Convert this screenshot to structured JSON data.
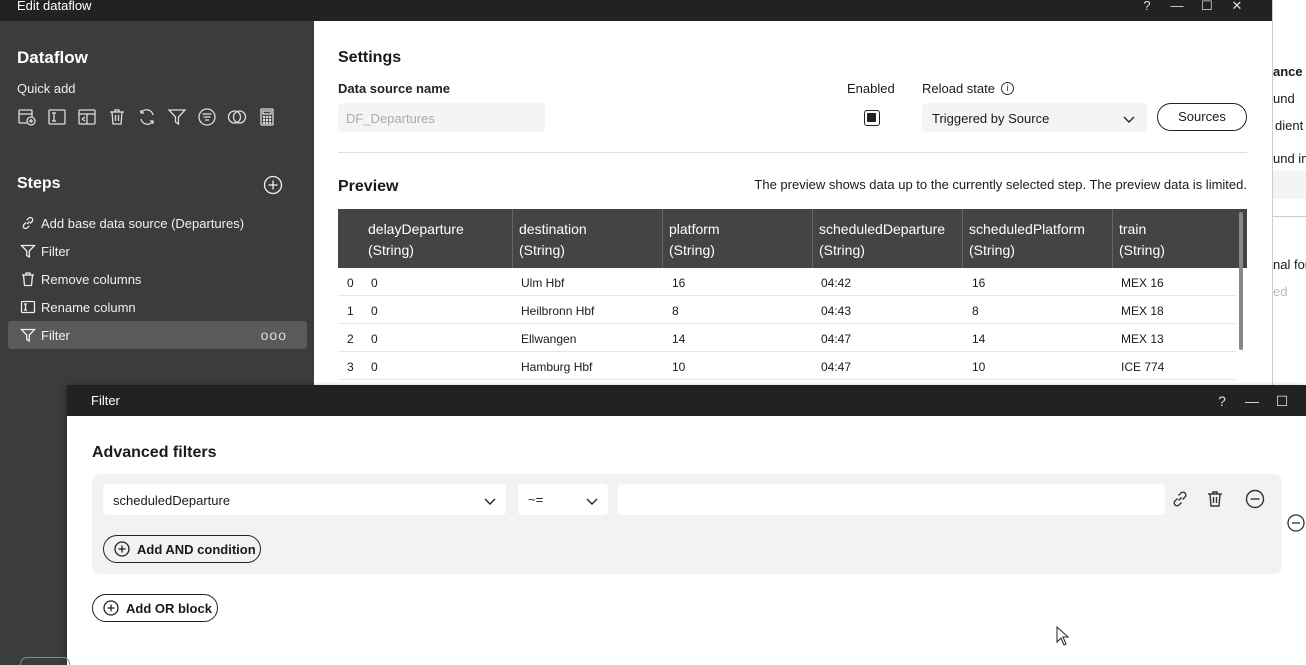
{
  "window": {
    "title": "Edit dataflow",
    "controls": [
      "?",
      "—",
      "☐",
      "✕"
    ]
  },
  "sidebar": {
    "heading": "Dataflow",
    "quick_add_label": "Quick add",
    "quick_add_icons": [
      "add-datasource-icon",
      "rename-column-icon",
      "add-column-icon",
      "delete-icon",
      "refresh-icon",
      "filter-icon",
      "sort-icon",
      "merge-icon",
      "calculator-icon"
    ],
    "steps_heading": "Steps",
    "steps": [
      {
        "label": "Add base data source (Departures)",
        "icon": "link-icon"
      },
      {
        "label": "Filter",
        "icon": "filter-icon"
      },
      {
        "label": "Remove columns",
        "icon": "delete-icon"
      },
      {
        "label": "Rename column",
        "icon": "rename-column-icon"
      },
      {
        "label": "Filter",
        "icon": "filter-icon",
        "active": true,
        "more": "ooo"
      }
    ]
  },
  "settings": {
    "heading": "Settings",
    "data_source_label": "Data source name",
    "data_source_placeholder": "DF_Departures",
    "enabled_label": "Enabled",
    "enabled_checked": true,
    "reload_label": "Reload state",
    "reload_value": "Triggered by Source",
    "sources_button": "Sources"
  },
  "preview": {
    "heading": "Preview",
    "note": "The preview shows data up to the currently selected step. The preview data is limited.",
    "columns": [
      {
        "name": "delayDeparture",
        "type": "(String)"
      },
      {
        "name": "destination",
        "type": "(String)"
      },
      {
        "name": "platform",
        "type": "(String)"
      },
      {
        "name": "scheduledDeparture",
        "type": "(String)"
      },
      {
        "name": "scheduledPlatform",
        "type": "(String)"
      },
      {
        "name": "train",
        "type": "(String)"
      }
    ],
    "rows": [
      [
        "0",
        "0",
        "Ulm Hbf",
        "16",
        "04:42",
        "16",
        "MEX 16"
      ],
      [
        "1",
        "0",
        "Heilbronn Hbf",
        "8",
        "04:43",
        "8",
        "MEX 18"
      ],
      [
        "2",
        "0",
        "Ellwangen",
        "14",
        "04:47",
        "14",
        "MEX 13"
      ],
      [
        "3",
        "0",
        "Hamburg Hbf",
        "10",
        "04:47",
        "10",
        "ICE 774"
      ]
    ]
  },
  "right_window": {
    "fragments": [
      "ance",
      "und",
      "dient",
      "und im",
      "nal for",
      "ed"
    ]
  },
  "filter_dialog": {
    "title": "Filter",
    "controls": [
      "?",
      "—",
      "☐"
    ],
    "heading": "Advanced filters",
    "condition": {
      "field": "scheduledDeparture",
      "operator": "~=",
      "value": ""
    },
    "add_and_label": "Add AND condition",
    "add_or_label": "Add OR block"
  }
}
